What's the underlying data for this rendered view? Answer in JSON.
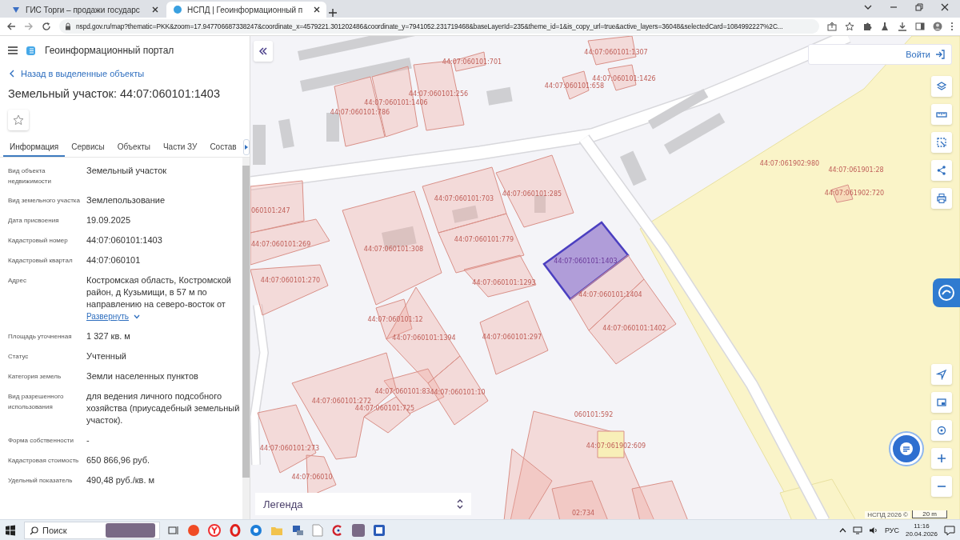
{
  "browser": {
    "tabs": [
      {
        "title": "ГИС Торги – продажи государс",
        "selected": false
      },
      {
        "title": "НСПД | Геоинформационный п",
        "selected": true
      }
    ],
    "url": "nspd.gov.ru/map?thematic=PKK&zoom=17.947706687338247&coordinate_x=4579221.301202486&coordinate_y=7941052.231719468&baseLayerId=235&theme_id=1&is_copy_url=true&active_layers=36048&selectedCard=1084992227%2C..."
  },
  "portal": {
    "title": "Геоинформационный портал"
  },
  "card": {
    "back_link": "Назад в выделенные объекты",
    "title": "Земельный участок: 44:07:060101:1403",
    "favorite": false,
    "tabs": [
      {
        "label": "Информация",
        "selected": true
      },
      {
        "label": "Сервисы",
        "selected": false
      },
      {
        "label": "Объекты",
        "selected": false
      },
      {
        "label": "Части ЗУ",
        "selected": false
      },
      {
        "label": "Состав",
        "selected": false
      }
    ],
    "fields": [
      {
        "label": "Вид объекта недвижимости",
        "value": "Земельный участок"
      },
      {
        "label": "Вид земельного участка",
        "value": "Землепользование"
      },
      {
        "label": "Дата присвоения",
        "value": "19.09.2025"
      },
      {
        "label": "Кадастровый номер",
        "value": "44:07:060101:1403"
      },
      {
        "label": "Кадастровый квартал",
        "value": "44:07:060101"
      },
      {
        "label": "Адрес",
        "value": "Костромская область, Костромской район, д Кузьмищи, в 57 м по направлению на северо-восток от",
        "link": "Развернуть"
      },
      {
        "label": "Площадь уточненная",
        "value": "1 327 кв. м"
      },
      {
        "label": "Статус",
        "value": "Учтенный"
      },
      {
        "label": "Категория земель",
        "value": "Земли населенных пунктов"
      },
      {
        "label": "Вид разрешенного использования",
        "value": "для ведения личного подсобного хозяйства (приусадебный земельный участок)."
      },
      {
        "label": "Форма собственности",
        "value": "-"
      },
      {
        "label": "Кадастровая стоимость",
        "value": "650 866,96 руб."
      },
      {
        "label": "Удельный показатель",
        "value": "490,48 руб./кв. м"
      }
    ]
  },
  "map": {
    "login_button": "Войти",
    "parcels": [
      {
        "label": "44:07:060101:701",
        "selected": false
      },
      {
        "label": "44:07:060101:1307",
        "selected": false
      },
      {
        "label": "44:07:060101:1426",
        "selected": false
      },
      {
        "label": "44:07:060101:658",
        "selected": false
      },
      {
        "label": "44:07:060101:256",
        "selected": false
      },
      {
        "label": "44:07:060101:1406",
        "selected": false
      },
      {
        "label": "44:07:060101:786",
        "selected": false
      },
      {
        "label": "44:07:060101:703",
        "selected": false
      },
      {
        "label": "44:07:060101:285",
        "selected": false
      },
      {
        "label": "060101:247",
        "selected": false
      },
      {
        "label": "44:07:060101:269",
        "selected": false
      },
      {
        "label": "44:07:060101:308",
        "selected": false
      },
      {
        "label": "44:07:060101:779",
        "selected": false
      },
      {
        "label": "44:07:060101:1403",
        "selected": true
      },
      {
        "label": "44:07:060101:270",
        "selected": false
      },
      {
        "label": "44:07:060101:1293",
        "selected": false
      },
      {
        "label": "44:07:060101:1404",
        "selected": false
      },
      {
        "label": "44:07:060101:12",
        "selected": false
      },
      {
        "label": "44:07:060101:1402",
        "selected": false
      },
      {
        "label": "44:07:060101:1394",
        "selected": false
      },
      {
        "label": "44:07:060101:297",
        "selected": false
      },
      {
        "label": "44:07:060101:83",
        "selected": false
      },
      {
        "label": "44:07:060101:10",
        "selected": false
      },
      {
        "label": "44:07:060101:272",
        "selected": false
      },
      {
        "label": "44:07:060101:725",
        "selected": false
      },
      {
        "label": "060101:592",
        "selected": false
      },
      {
        "label": "44:07:061902:609",
        "selected": false
      },
      {
        "label": "44:07:060101:273",
        "selected": false
      },
      {
        "label": "44:07:06010",
        "selected": false
      },
      {
        "label": "02:734",
        "selected": false
      },
      {
        "label": "44:07:061902:980",
        "selected": false
      },
      {
        "label": "44:07:061901:28",
        "selected": false
      },
      {
        "label": "44:07:061902:720",
        "selected": false
      }
    ],
    "legend": "Легенда",
    "attribution": "НСПД 2026 ©",
    "scale": "20 m"
  },
  "taskbar": {
    "search_placeholder": "Поиск",
    "language": "РУС",
    "time": "11:16",
    "date": "20.04.2026"
  }
}
